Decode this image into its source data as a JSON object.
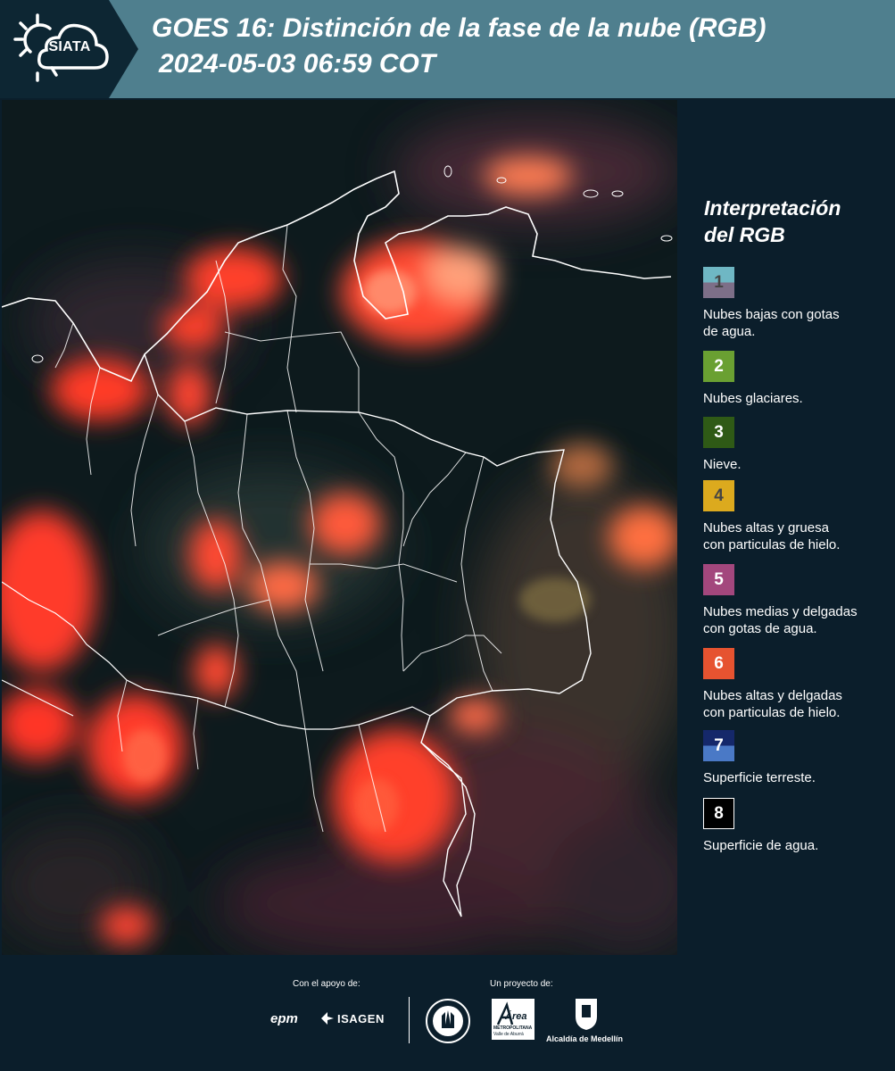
{
  "header": {
    "logo_text": "SIATA",
    "title": "GOES 16: Distinción de la fase de la nube (RGB)",
    "subtitle": "2024-05-03 06:59 COT"
  },
  "legend": {
    "title_line1": "Interpretación",
    "title_line2": "del RGB",
    "items": [
      {
        "number": "1",
        "color_top": "#6fb7c4",
        "color_bottom": "#7d6f88",
        "label_line1": "Nubes bajas con gotas",
        "label_line2": "de agua."
      },
      {
        "number": "2",
        "color": "#6aa032",
        "label_line1": "Nubes glaciares.",
        "label_line2": ""
      },
      {
        "number": "3",
        "color": "#2f5a16",
        "label_line1": "Nieve.",
        "label_line2": ""
      },
      {
        "number": "4",
        "color": "#dcaa1e",
        "label_line1": "Nubes altas y gruesa",
        "label_line2": "con particulas de hielo."
      },
      {
        "number": "5",
        "color": "#a3477d",
        "label_line1": "Nubes medias y delgadas",
        "label_line2": "con gotas de agua."
      },
      {
        "number": "6",
        "color": "#e65330",
        "label_line1": "Nubes altas y delgadas",
        "label_line2": "con particulas de hielo."
      },
      {
        "number": "7",
        "color_top": "#15286a",
        "color_bottom": "#4a79c6",
        "label_line1": "Superficie terreste.",
        "label_line2": ""
      },
      {
        "number": "8",
        "color": "#000000",
        "border": "#ffffff",
        "label_line1": "Superficie de agua.",
        "label_line2": ""
      }
    ]
  },
  "footer": {
    "support_label": "Con el apoyo de:",
    "project_label": "Un proyecto de:",
    "sponsor1": "epm",
    "sponsor2": "ISAGEN",
    "partner_area": "Área",
    "partner_area_sub1": "METROPOLITANA",
    "partner_area_sub2": "Valle de Aburrá",
    "partner_alcaldia": "Alcaldía de Medellín"
  }
}
